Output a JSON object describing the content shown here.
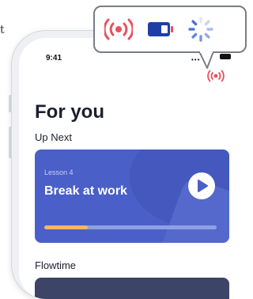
{
  "edge_text": "t",
  "status": {
    "time": "9:41",
    "signal": "•••"
  },
  "main": {
    "title": "For you",
    "up_next": {
      "section_label": "Up Next",
      "lesson": "Lesson 4",
      "title": "Break at work",
      "progress": 0.25
    },
    "flowtime": {
      "section_label": "Flowtime"
    }
  },
  "callout": {
    "icons": [
      "broadcast-icon",
      "battery-icon",
      "loading-spinner-icon"
    ]
  },
  "colors": {
    "accent_red": "#e8505b",
    "card_blue": "#4a5fc7",
    "progress_orange": "#f6b562",
    "spinner_blue": "#4a6fd8"
  }
}
